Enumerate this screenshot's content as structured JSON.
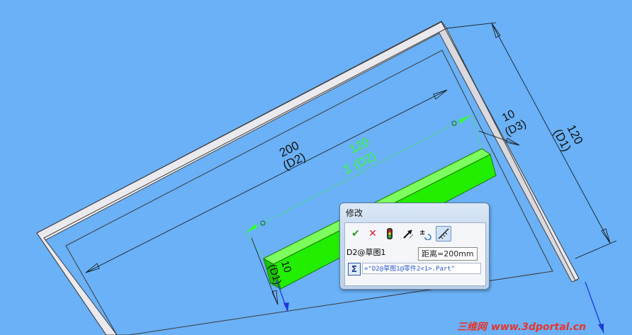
{
  "viewport": {
    "background": "#6ab1f7",
    "frame_color": "#e6e6ec",
    "part_color": "#22ee00",
    "active_dim_color": "#33ff33"
  },
  "dimensions": {
    "d2": {
      "value": "200",
      "name": "(D2)"
    },
    "d1": {
      "value": "120",
      "name": "(D1)"
    },
    "d3": {
      "value": "10",
      "name": "(D3)"
    },
    "active": {
      "value": "120",
      "name": "Σ (D2)"
    },
    "small": {
      "value": "10",
      "name": "(D1)"
    }
  },
  "dialog": {
    "title": "修改",
    "dimension_name": "D2@草图1",
    "tooltip": "距离=200mm",
    "equation": "=\"D2@草图1@零件2<1>.Part\"",
    "tools": [
      "check-icon",
      "close-icon",
      "rebuild-icon",
      "regenerate-icon",
      "reverse-icon",
      "mark-dim-icon"
    ]
  },
  "watermark": {
    "site_name": "三维网",
    "url": "www.3dportal.cn"
  }
}
